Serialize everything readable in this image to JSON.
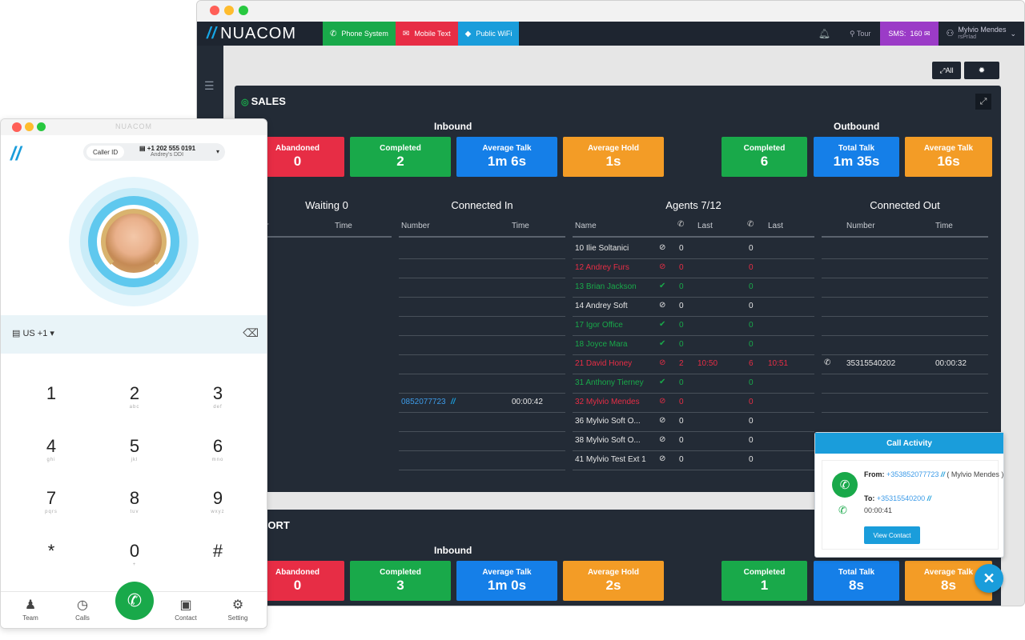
{
  "main": {
    "logo": "NUACOM",
    "tabs": [
      {
        "label": "Phone System",
        "icon": "phone-icon"
      },
      {
        "label": "Mobile Text",
        "icon": "message-icon"
      },
      {
        "label": "Public WiFi",
        "icon": "wifi-icon"
      }
    ],
    "tour": "Tour",
    "sms_label": "SMS:",
    "sms_count": "160",
    "user_name": "Mylvio Mendes",
    "user_sub": "rsPrIad",
    "all_button": "All"
  },
  "sales": {
    "title": "SALES",
    "inbound_label": "Inbound",
    "outbound_label": "Outbound",
    "inbound_stats": [
      {
        "label": "Abandoned",
        "value": "0",
        "color": "#e72d45"
      },
      {
        "label": "Completed",
        "value": "2",
        "color": "#19a94a"
      },
      {
        "label": "Average Talk",
        "value": "1m 6s",
        "color": "#157fe8"
      },
      {
        "label": "Average Hold",
        "value": "1s",
        "color": "#f39c26"
      }
    ],
    "outbound_stats": [
      {
        "label": "Completed",
        "value": "6",
        "color": "#19a94a"
      },
      {
        "label": "Total Talk",
        "value": "1m 35s",
        "color": "#157fe8"
      },
      {
        "label": "Average Talk",
        "value": "16s",
        "color": "#f39c26"
      }
    ],
    "waiting": {
      "title": "Waiting 0",
      "col1": "ber",
      "col2": "Time"
    },
    "connected_in": {
      "title": "Connected In",
      "col1": "Number",
      "col2": "Time",
      "rows": [
        {
          "number": "",
          "time": ""
        },
        {
          "number": "",
          "time": ""
        },
        {
          "number": "",
          "time": ""
        },
        {
          "number": "",
          "time": ""
        },
        {
          "number": "",
          "time": ""
        },
        {
          "number": "",
          "time": ""
        },
        {
          "number": "",
          "time": ""
        },
        {
          "number": "",
          "time": ""
        },
        {
          "number": "0852077723",
          "time": "00:00:42"
        },
        {
          "number": "",
          "time": ""
        },
        {
          "number": "",
          "time": ""
        },
        {
          "number": "",
          "time": ""
        }
      ]
    },
    "agents": {
      "title": "Agents 7/12",
      "col_name": "Name",
      "col_last": "Last",
      "col_last2": "Last",
      "rows": [
        {
          "name": "10 Ilie Soltanici",
          "status": "busy",
          "c1": "0",
          "l1": "",
          "c2": "0",
          "l2": "",
          "color": "white"
        },
        {
          "name": "12 Andrey Furs",
          "status": "busy",
          "c1": "0",
          "l1": "",
          "c2": "0",
          "l2": "",
          "color": "red"
        },
        {
          "name": "13 Brian Jackson",
          "status": "ok",
          "c1": "0",
          "l1": "",
          "c2": "0",
          "l2": "",
          "color": "green"
        },
        {
          "name": "14 Andrey Soft",
          "status": "busy",
          "c1": "0",
          "l1": "",
          "c2": "0",
          "l2": "",
          "color": "white"
        },
        {
          "name": "17 Igor Office",
          "status": "ok",
          "c1": "0",
          "l1": "",
          "c2": "0",
          "l2": "",
          "color": "green"
        },
        {
          "name": "18 Joyce Mara",
          "status": "ok",
          "c1": "0",
          "l1": "",
          "c2": "0",
          "l2": "",
          "color": "green"
        },
        {
          "name": "21 David Honey",
          "status": "busy",
          "c1": "2",
          "l1": "10:50",
          "c2": "6",
          "l2": "10:51",
          "color": "red"
        },
        {
          "name": "31 Anthony Tierney",
          "status": "ok",
          "c1": "0",
          "l1": "",
          "c2": "0",
          "l2": "",
          "color": "green"
        },
        {
          "name": "32 Mylvio Mendes",
          "status": "busy",
          "c1": "0",
          "l1": "",
          "c2": "0",
          "l2": "",
          "color": "red"
        },
        {
          "name": "36 Mylvio Soft O...",
          "status": "busy",
          "c1": "0",
          "l1": "",
          "c2": "0",
          "l2": "",
          "color": "white"
        },
        {
          "name": "38 Mylvio Soft O...",
          "status": "busy",
          "c1": "0",
          "l1": "",
          "c2": "0",
          "l2": "",
          "color": "white"
        },
        {
          "name": "41 Mylvio Test Ext 1",
          "status": "busy",
          "c1": "0",
          "l1": "",
          "c2": "0",
          "l2": "",
          "color": "white"
        }
      ]
    },
    "connected_out": {
      "title": "Connected Out",
      "col1": "Number",
      "col2": "Time",
      "rows": [
        {
          "number": "",
          "time": ""
        },
        {
          "number": "",
          "time": ""
        },
        {
          "number": "",
          "time": ""
        },
        {
          "number": "",
          "time": ""
        },
        {
          "number": "",
          "time": ""
        },
        {
          "number": "",
          "time": ""
        },
        {
          "number": "35315540202",
          "time": "00:00:32"
        },
        {
          "number": "",
          "time": ""
        },
        {
          "number": "",
          "time": ""
        }
      ]
    }
  },
  "support": {
    "title": "PPORT",
    "inbound_label": "Inbound",
    "inbound_stats": [
      {
        "label": "Abandoned",
        "value": "0",
        "color": "#e72d45"
      },
      {
        "label": "Completed",
        "value": "3",
        "color": "#19a94a"
      },
      {
        "label": "Average Talk",
        "value": "1m 0s",
        "color": "#157fe8"
      },
      {
        "label": "Average Hold",
        "value": "2s",
        "color": "#f39c26"
      }
    ],
    "outbound_stats": [
      {
        "label": "Completed",
        "value": "1",
        "color": "#19a94a"
      },
      {
        "label": "Total Talk",
        "value": "8s",
        "color": "#157fe8"
      },
      {
        "label": "Average Talk",
        "value": "8s",
        "color": "#f39c26"
      }
    ]
  },
  "phone": {
    "title": "NUACOM",
    "caller_id_label": "Caller ID",
    "caller_number": "+1 202 555 0191",
    "caller_ddi": "Andrey's DDI",
    "country": "US +1",
    "keys": [
      {
        "d": "1",
        "s": ""
      },
      {
        "d": "2",
        "s": "abc"
      },
      {
        "d": "3",
        "s": "def"
      },
      {
        "d": "4",
        "s": "ghi"
      },
      {
        "d": "5",
        "s": "jkl"
      },
      {
        "d": "6",
        "s": "mno"
      },
      {
        "d": "7",
        "s": "pqrs"
      },
      {
        "d": "8",
        "s": "tuv"
      },
      {
        "d": "9",
        "s": "wxyz"
      },
      {
        "d": "*",
        "s": ""
      },
      {
        "d": "0",
        "s": "+"
      },
      {
        "d": "#",
        "s": ""
      }
    ],
    "nav": [
      {
        "label": "Team",
        "icon": "team-icon"
      },
      {
        "label": "Calls",
        "icon": "clock-icon"
      },
      {
        "label": "Contact",
        "icon": "contact-icon"
      },
      {
        "label": "Setting",
        "icon": "gear-icon"
      }
    ]
  },
  "call_activity": {
    "title": "Call Activity",
    "from_label": "From:",
    "from_number": "+353852077723",
    "from_name": "( Mylvio Mendes )",
    "to_label": "To:",
    "to_number": "+35315540200",
    "duration": "00:00:41",
    "button": "View Contact"
  },
  "colors": {
    "accent": "#1a9ddb",
    "green": "#19a94a",
    "red": "#e72d45",
    "blue": "#157fe8",
    "orange": "#f39c26",
    "panel": "#232b36",
    "sms": "#9b3bc7"
  }
}
